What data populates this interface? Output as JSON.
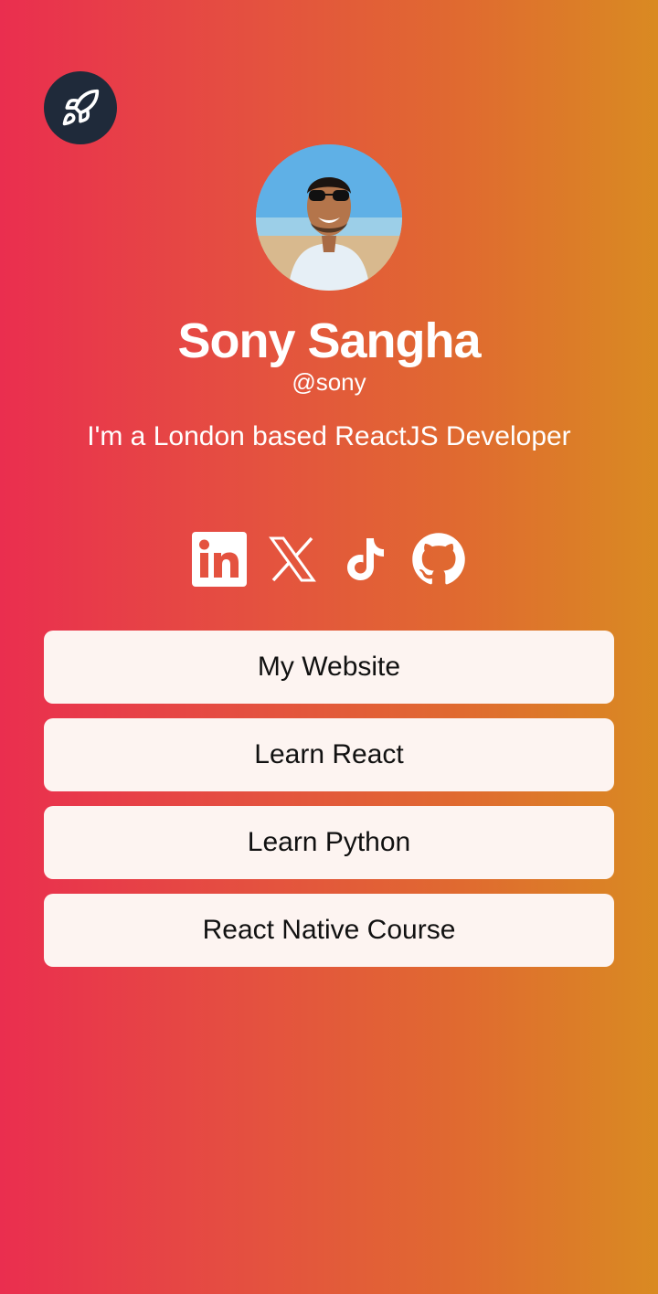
{
  "profile": {
    "name": "Sony Sangha",
    "handle": "@sony",
    "bio": "I'm a London based ReactJS Developer"
  },
  "icons": {
    "share": "rocket-icon",
    "socials": [
      "linkedin-icon",
      "x-icon",
      "tiktok-icon",
      "github-icon"
    ]
  },
  "links": [
    {
      "label": "My Website"
    },
    {
      "label": "Learn React"
    },
    {
      "label": "Learn Python"
    },
    {
      "label": "React Native Course"
    }
  ],
  "colors": {
    "gradient_start": "#ea2e4f",
    "gradient_end": "#d98a22",
    "button_bg": "#fdf4f1",
    "share_bg": "#1f2a3a"
  }
}
